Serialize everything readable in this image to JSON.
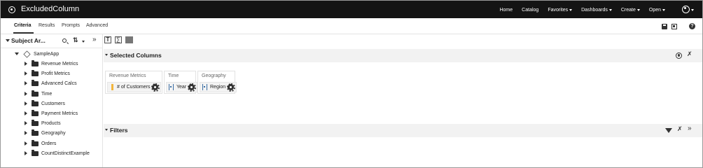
{
  "header": {
    "title": "ExcludedColumn",
    "nav": [
      "Home",
      "Catalog",
      "Favorites",
      "Dashboards",
      "Create",
      "Open"
    ]
  },
  "tabs": [
    "Criteria",
    "Results",
    "Prompts",
    "Advanced"
  ],
  "subject_area": {
    "title": "Subject Ar...",
    "root": "SampleApp",
    "folders": [
      "Revenue Metrics",
      "Profit Metrics",
      "Advanced Calcs",
      "Time",
      "Customers",
      "Payment Metrics",
      "Products",
      "Geography",
      "Orders",
      "CountDistinctExample"
    ]
  },
  "selected_columns": {
    "title": "Selected Columns",
    "groups": [
      {
        "heading": "Revenue Metrics",
        "column": "# of Customers",
        "kind": "measure"
      },
      {
        "heading": "Time",
        "column": "Year",
        "kind": "attribute"
      },
      {
        "heading": "Geography",
        "column": "Region",
        "kind": "attribute"
      }
    ]
  },
  "filters": {
    "title": "Filters"
  },
  "colors": {
    "topbar": "#141414",
    "measure": "#f2b53b",
    "attribute": "#3a6ea5"
  }
}
